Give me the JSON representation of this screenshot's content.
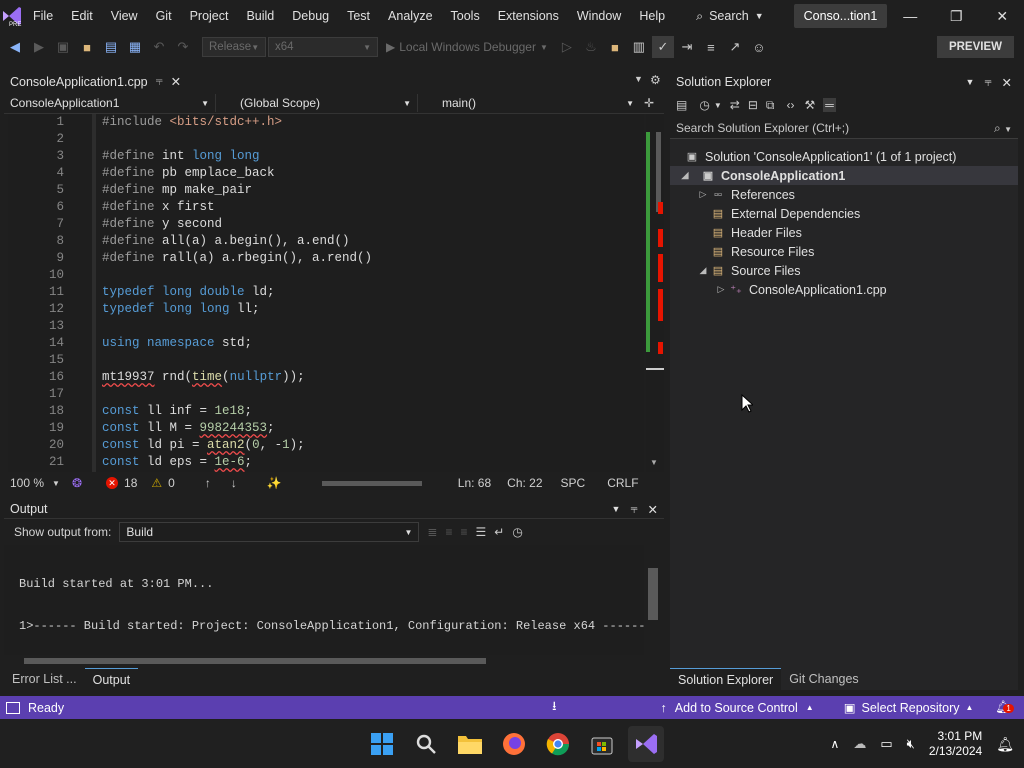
{
  "menubar": {
    "items": [
      "File",
      "Edit",
      "View",
      "Git",
      "Project",
      "Build",
      "Debug",
      "Test",
      "Analyze",
      "Tools",
      "Extensions",
      "Window",
      "Help"
    ],
    "search_label": "Search",
    "solution_title": "Conso...tion1"
  },
  "toolbar": {
    "config": "Release",
    "platform": "x64",
    "debugger": "Local Windows Debugger",
    "preview": "PREVIEW"
  },
  "editor": {
    "tab_title": "ConsoleApplication1.cpp",
    "nav_project": "ConsoleApplication1",
    "nav_scope": "(Global Scope)",
    "nav_function": "main()",
    "lines": [
      {
        "n": "1"
      },
      {
        "n": "2"
      },
      {
        "n": "3"
      },
      {
        "n": "4"
      },
      {
        "n": "5"
      },
      {
        "n": "6"
      },
      {
        "n": "7"
      },
      {
        "n": "8"
      },
      {
        "n": "9"
      },
      {
        "n": "10"
      },
      {
        "n": "11"
      },
      {
        "n": "12"
      },
      {
        "n": "13"
      },
      {
        "n": "14"
      },
      {
        "n": "15"
      },
      {
        "n": "16"
      },
      {
        "n": "17"
      },
      {
        "n": "18"
      },
      {
        "n": "19"
      },
      {
        "n": "20"
      },
      {
        "n": "21"
      }
    ],
    "code": {
      "l1_dir": "#include",
      "l1_hdr": " <bits/stdc++.h>",
      "l3_dir": "#define",
      "l3_a": " int",
      "l3_b": " long long",
      "l4_dir": "#define",
      "l4_a": " pb",
      "l4_b": " emplace_back",
      "l5_dir": "#define",
      "l5_a": " mp",
      "l5_b": " make_pair",
      "l6_dir": "#define",
      "l6_a": " x",
      "l6_b": " first",
      "l7_dir": "#define",
      "l7_a": " y",
      "l7_b": " second",
      "l8_dir": "#define",
      "l8_a": " all(a)",
      "l8_b": " a.begin(), a.end()",
      "l9_dir": "#define",
      "l9_a": " rall(a)",
      "l9_b": " a.rbegin(), a.rend()",
      "l11_kw": "typedef",
      "l11_t": " long double",
      "l11_r": " ld;",
      "l12_kw": "typedef",
      "l12_t": " long long",
      "l12_r": " ll;",
      "l14_kw": "using",
      "l14_ns": " namespace",
      "l14_r": " std;",
      "l16_t": "mt19937",
      "l16_a": " rnd(",
      "l16_fn": "time",
      "l16_b": "(",
      "l16_kw": "nullptr",
      "l16_c": "));",
      "l18_kw": "const",
      "l18_a": " ll inf = ",
      "l18_n": "1e18",
      "l18_e": ";",
      "l19_kw": "const",
      "l19_a": " ll M = ",
      "l19_n": "998244353",
      "l19_e": ";",
      "l20_kw": "const",
      "l20_a": " ld pi = ",
      "l20_fn": "atan2",
      "l20_b": "(",
      "l20_n1": "0",
      "l20_c": ", -",
      "l20_n2": "1",
      "l20_e": ");",
      "l21_kw": "const",
      "l21_a": " ld eps = ",
      "l21_n": "1e-6",
      "l21_e": ";"
    },
    "zoom": "100 %",
    "errors": "18",
    "warnings": "0",
    "line": "Ln: 68",
    "col": "Ch: 22",
    "indent": "SPC",
    "eol": "CRLF"
  },
  "output": {
    "title": "Output",
    "show_from_label": "Show output from:",
    "source": "Build",
    "lines": [
      "Build started at 3:01 PM...",
      "1>------ Build started: Project: ConsoleApplication1, Configuration: Release x64 ------"
    ],
    "tabs": [
      "Error List ...",
      "Output"
    ]
  },
  "solution_explorer": {
    "title": "Solution Explorer",
    "search_placeholder": "Search Solution Explorer (Ctrl+;)",
    "solution_node": "Solution 'ConsoleApplication1' (1 of 1 project)",
    "project_node": "ConsoleApplication1",
    "nodes": [
      "References",
      "External Dependencies",
      "Header Files",
      "Resource Files",
      "Source Files"
    ],
    "file_node": "ConsoleApplication1.cpp",
    "tabs": [
      "Solution Explorer",
      "Git Changes"
    ]
  },
  "statusbar": {
    "ready": "Ready",
    "add_source": "Add to Source Control",
    "select_repo": "Select Repository",
    "notif_count": "1"
  },
  "taskbar": {
    "time": "3:01 PM",
    "date": "2/13/2024"
  },
  "colors": {
    "status_bar": "#5b3fb0",
    "accent": "#569cd6"
  }
}
